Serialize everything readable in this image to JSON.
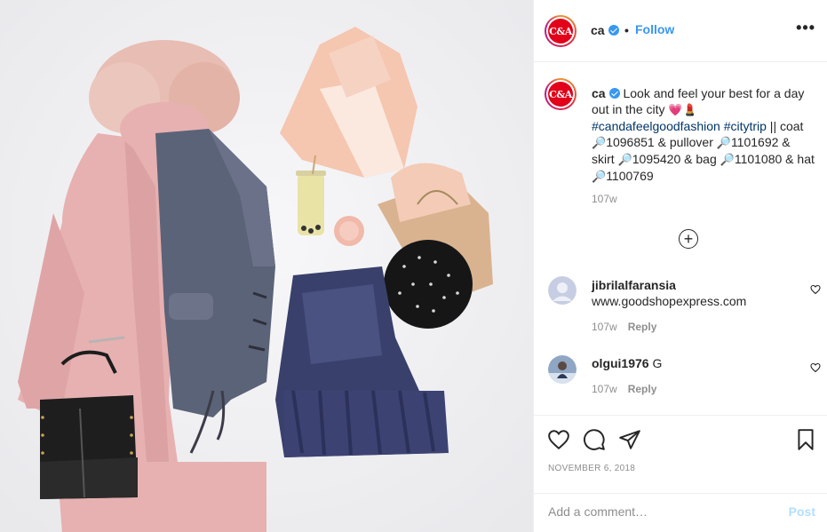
{
  "post": {
    "image_alt": "",
    "author": {
      "username": "ca",
      "logo_text": "C&A",
      "verified": true
    },
    "follow_label": "Follow",
    "more_label": "•••",
    "separator": "•"
  },
  "caption": {
    "username": "ca",
    "text_1": "Look and feel your best for a day out in the city ",
    "emoji_1": "💗💄",
    "hashtag_1": "#candafeelgoodfashion",
    "hashtag_2": "#citytrip",
    "text_2": " || coat ",
    "search_emoji": "🔎",
    "coat_code": "1096851",
    "amp": " & ",
    "pullover_label": "pullover ",
    "pullover_code": "1101692",
    "skirt_label": "skirt ",
    "skirt_code": "1095420",
    "bag_label": "bag ",
    "bag_code": "1101080",
    "hat_label": "hat ",
    "hat_code": "1100769",
    "time": "107w"
  },
  "load_more_label": "+",
  "comments": [
    {
      "username": "jibrilalfaransia",
      "text": "www.goodshopexpress.com",
      "time": "107w",
      "reply": "Reply"
    },
    {
      "username": "olgui1976",
      "text": "G",
      "time": "107w",
      "reply": "Reply"
    }
  ],
  "actions": {
    "like_icon": "heart-outline",
    "comment_icon": "speech-bubble",
    "share_icon": "paper-plane",
    "save_icon": "bookmark",
    "date": "NOVEMBER 6, 2018"
  },
  "comment_box": {
    "placeholder": "Add a comment…",
    "post_label": "Post"
  },
  "colors": {
    "link_blue": "#3897f0",
    "hashtag": "#003569",
    "muted": "#8e8e8e",
    "brand_red": "#e2001a"
  }
}
